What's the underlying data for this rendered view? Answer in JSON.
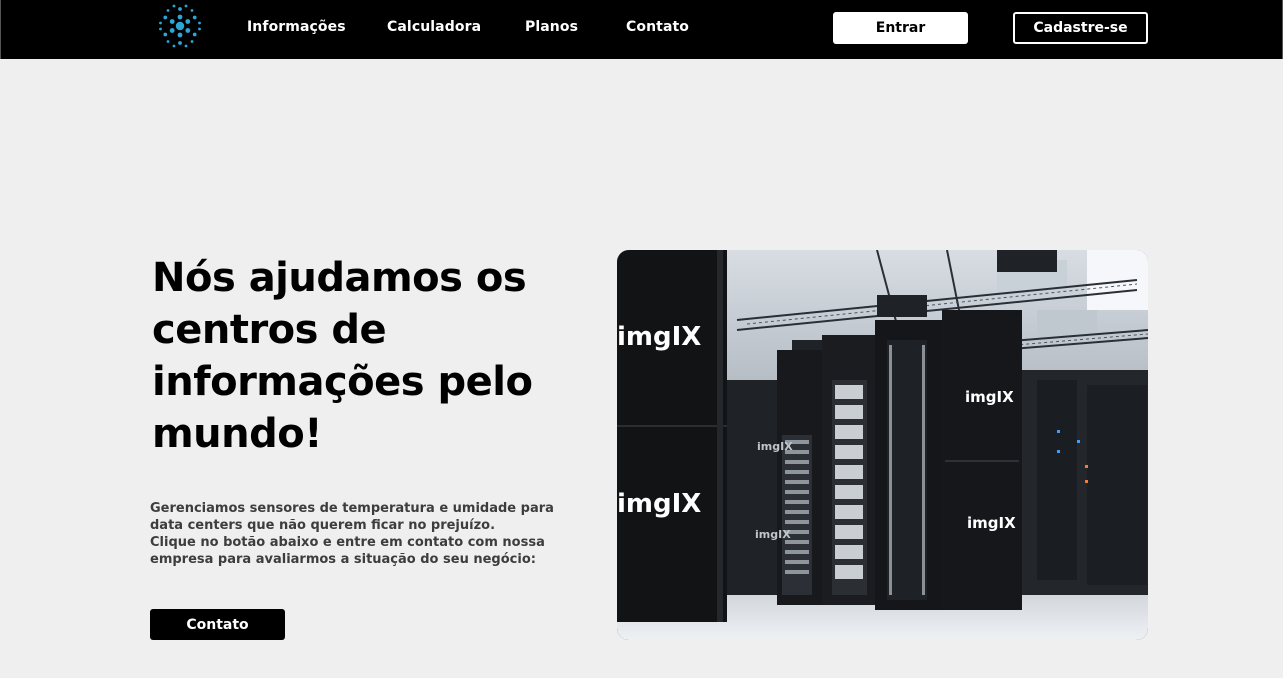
{
  "nav": {
    "logo_icon": "snowflake-dots-icon",
    "links": [
      "Informações",
      "Calculadora",
      "Planos",
      "Contato"
    ],
    "login_label": "Entrar",
    "signup_label": "Cadastre-se"
  },
  "hero": {
    "title": "Nós ajudamos os centros de informações pelo mundo!",
    "description_lines": [
      "Gerenciamos sensores de temperatura e umidade para",
      "data centers que não querem ficar no prejuízo.",
      "Clique no botão abaixo e entre em contato com nossa",
      "empresa para avaliarmos a situação do seu negócio:"
    ],
    "cta_label": "Contato",
    "image_brand": "imgIX"
  },
  "colors": {
    "nav_background": "#000000",
    "page_background": "#efefef",
    "logo_accent": "#2aa7d6"
  }
}
